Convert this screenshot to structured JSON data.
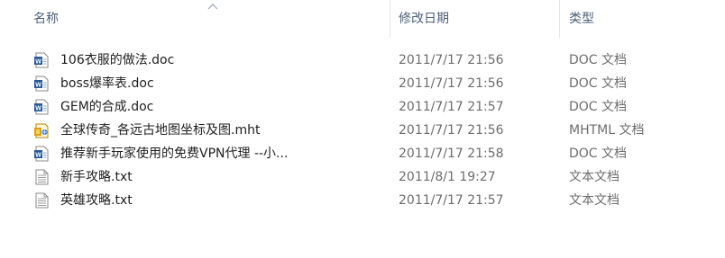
{
  "header": {
    "name_label": "名称",
    "date_label": "修改日期",
    "type_label": "类型",
    "sort_indicator_icon": "chevron-up-icon"
  },
  "files": [
    {
      "name": "106衣服的做法.doc",
      "date": "2011/7/17 21:56",
      "type": "DOC 文档",
      "icon": "word-doc-icon"
    },
    {
      "name": "boss爆率表.doc",
      "date": "2011/7/17 21:56",
      "type": "DOC 文档",
      "icon": "word-doc-icon"
    },
    {
      "name": "GEM的合成.doc",
      "date": "2011/7/17 21:57",
      "type": "DOC 文档",
      "icon": "word-doc-icon"
    },
    {
      "name": "全球传奇_各远古地图坐标及图.mht",
      "date": "2011/7/17 21:56",
      "type": "MHTML 文档",
      "icon": "mhtml-icon"
    },
    {
      "name": "推荐新手玩家使用的免费VPN代理 --小...",
      "date": "2011/7/17 21:58",
      "type": "DOC 文档",
      "icon": "word-doc-icon"
    },
    {
      "name": "新手攻略.txt",
      "date": "2011/8/1 19:27",
      "type": "文本文档",
      "icon": "text-file-icon"
    },
    {
      "name": "英雄攻略.txt",
      "date": "2011/7/17 21:57",
      "type": "文本文档",
      "icon": "text-file-icon"
    }
  ],
  "colors": {
    "header_text": "#4c607a",
    "detail_text": "#6d6d6d",
    "name_text": "#1e1e1e",
    "word_icon": "#2b579a",
    "mhtml_icon": "#d8a216"
  }
}
